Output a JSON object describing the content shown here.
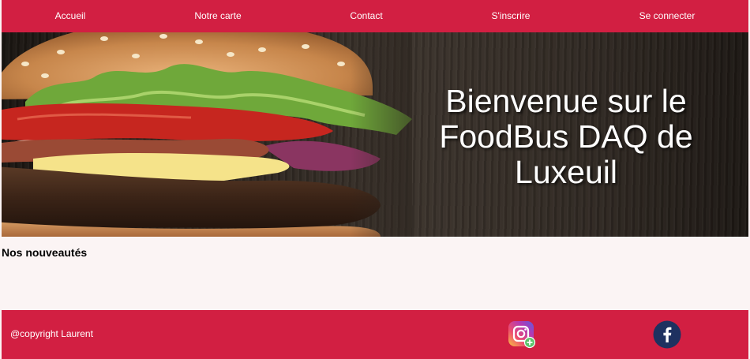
{
  "nav": {
    "items": [
      {
        "label": "Accueil"
      },
      {
        "label": "Notre carte"
      },
      {
        "label": "Contact"
      },
      {
        "label": "S'inscrire"
      },
      {
        "label": "Se connecter"
      }
    ]
  },
  "hero": {
    "title": "Bienvenue sur le FoodBus DAQ de Luxeuil",
    "image": "burger-photo"
  },
  "section": {
    "title": "Nos nouveautés"
  },
  "footer": {
    "copyright": "@copyright Laurent",
    "social": [
      {
        "icon": "instagram-icon"
      },
      {
        "icon": "facebook-icon"
      }
    ]
  },
  "colors": {
    "brand": "#d21f42",
    "background": "#fbf4f4",
    "facebook": "#1e3160"
  }
}
